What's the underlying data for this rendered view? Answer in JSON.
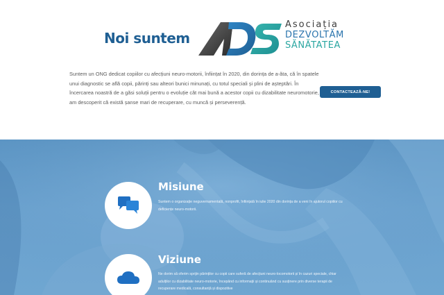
{
  "header": {
    "title": "Noi suntem",
    "logo": {
      "mark": "ADS",
      "line1": "Asociația",
      "line2": "DEZVOLTĂM",
      "line3": "SĂNĂTATEA",
      "colors": {
        "dark": "#3d3d3d",
        "blue": "#2a74ad",
        "teal": "#2aa6a1"
      }
    }
  },
  "intro": {
    "text": "Suntem un ONG dedicat copiilor cu afecțiuni neuro-motorii, înființat în 2020, din dorința de a-ăta, că în spatele unui diagnostic se află copii, părinți sau alteori bunici minunați, cu totul speciali și plini de așteptări. În încercarea noastră de a găsi soluții pentru o evoluție cât mai bună a acestor copii cu dizabilitate neuromotorie, am descoperit că există șanse mari de recuperare, cu muncă și perseverență."
  },
  "cta": {
    "label": "CONTACTEAZĂ-NE!"
  },
  "sections": [
    {
      "icon": "speech-bubbles-icon",
      "title": "Misiune",
      "text": "Suntem o organizație neguvernamentală, nonprofit, înființată în iulie 2020 din dorința de a veni în ajutorul copiilor cu deficiențe neuro-motorii."
    },
    {
      "icon": "cloud-icon",
      "title": "Viziune",
      "text": "Ne dorim să oferim sprijin părinților cu copii care suferă de afecțiuni neuro-locomotorii și în cazuri speciale, chiar adulților cu dizabilitate neuro-motorie, începând cu informații și continuând cu susținere prin diverse terapii de recuperare medicală, consultanță și dispozitive"
    }
  ],
  "colors": {
    "primary": "#1f5f93",
    "hero": "#6aa2cf"
  }
}
